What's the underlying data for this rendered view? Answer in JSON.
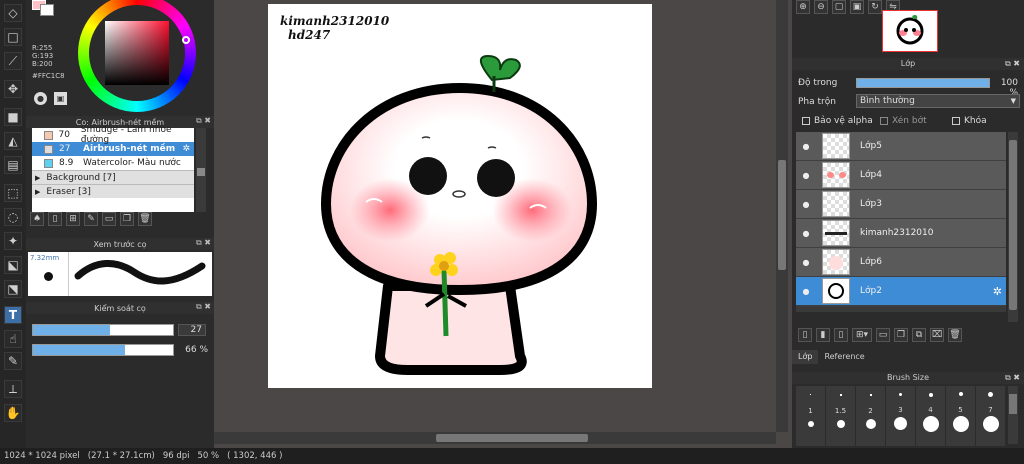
{
  "color_panel": {
    "rgb": [
      "R:255",
      "G:193",
      "B:200"
    ],
    "hex": "#FFC1C8"
  },
  "brush_panel": {
    "title": "Cọ: Airbrush-nét mềm",
    "items": [
      {
        "size": "70",
        "name": "Smudge - Làm nhòe đường"
      },
      {
        "size": "27",
        "name": "Airbrush-nét mềm"
      },
      {
        "size": "8.9",
        "name": "Watercolor- Màu nước"
      }
    ],
    "groups": [
      "Background [7]",
      "Eraser [3]"
    ]
  },
  "preview_panel": {
    "title": "Xem trước cọ",
    "size": "7.32mm"
  },
  "control_panel": {
    "title": "Kiểm soát cọ",
    "size_value": "27",
    "opacity_value": "66 %",
    "size_fill": 0.55,
    "opacity_fill": 0.66
  },
  "canvas": {
    "text_line1": "kimanh2312010",
    "text_line2": "hd247"
  },
  "layer_panel": {
    "title": "Lớp",
    "opacity_label": "Độ trong",
    "opacity_value": "100 %",
    "blend_label": "Pha trộn",
    "blend_value": "Bình thường",
    "protect_alpha": "Bảo vệ alpha",
    "clip": "Xén bớt",
    "lock": "Khóa",
    "layers": [
      "Lớp5",
      "Lớp4",
      "Lớp3",
      "kimanh2312010",
      "Lớp6",
      "Lớp2"
    ],
    "tabs": [
      "Lớp",
      "Reference"
    ]
  },
  "brushsize_panel": {
    "title": "Brush Size",
    "sizes": [
      "1",
      "1.5",
      "2",
      "3",
      "4",
      "5",
      "7"
    ]
  },
  "status": {
    "size": "1024 * 1024 pixel",
    "cm": "(27.1 * 27.1cm)",
    "dpi": "96 dpi",
    "zoom": "50 %",
    "coords": "( 1302, 446 )"
  },
  "colors": {
    "accent": "#3e8bd6",
    "primary": "#ffc1c8",
    "secondary": "#ffffff"
  }
}
